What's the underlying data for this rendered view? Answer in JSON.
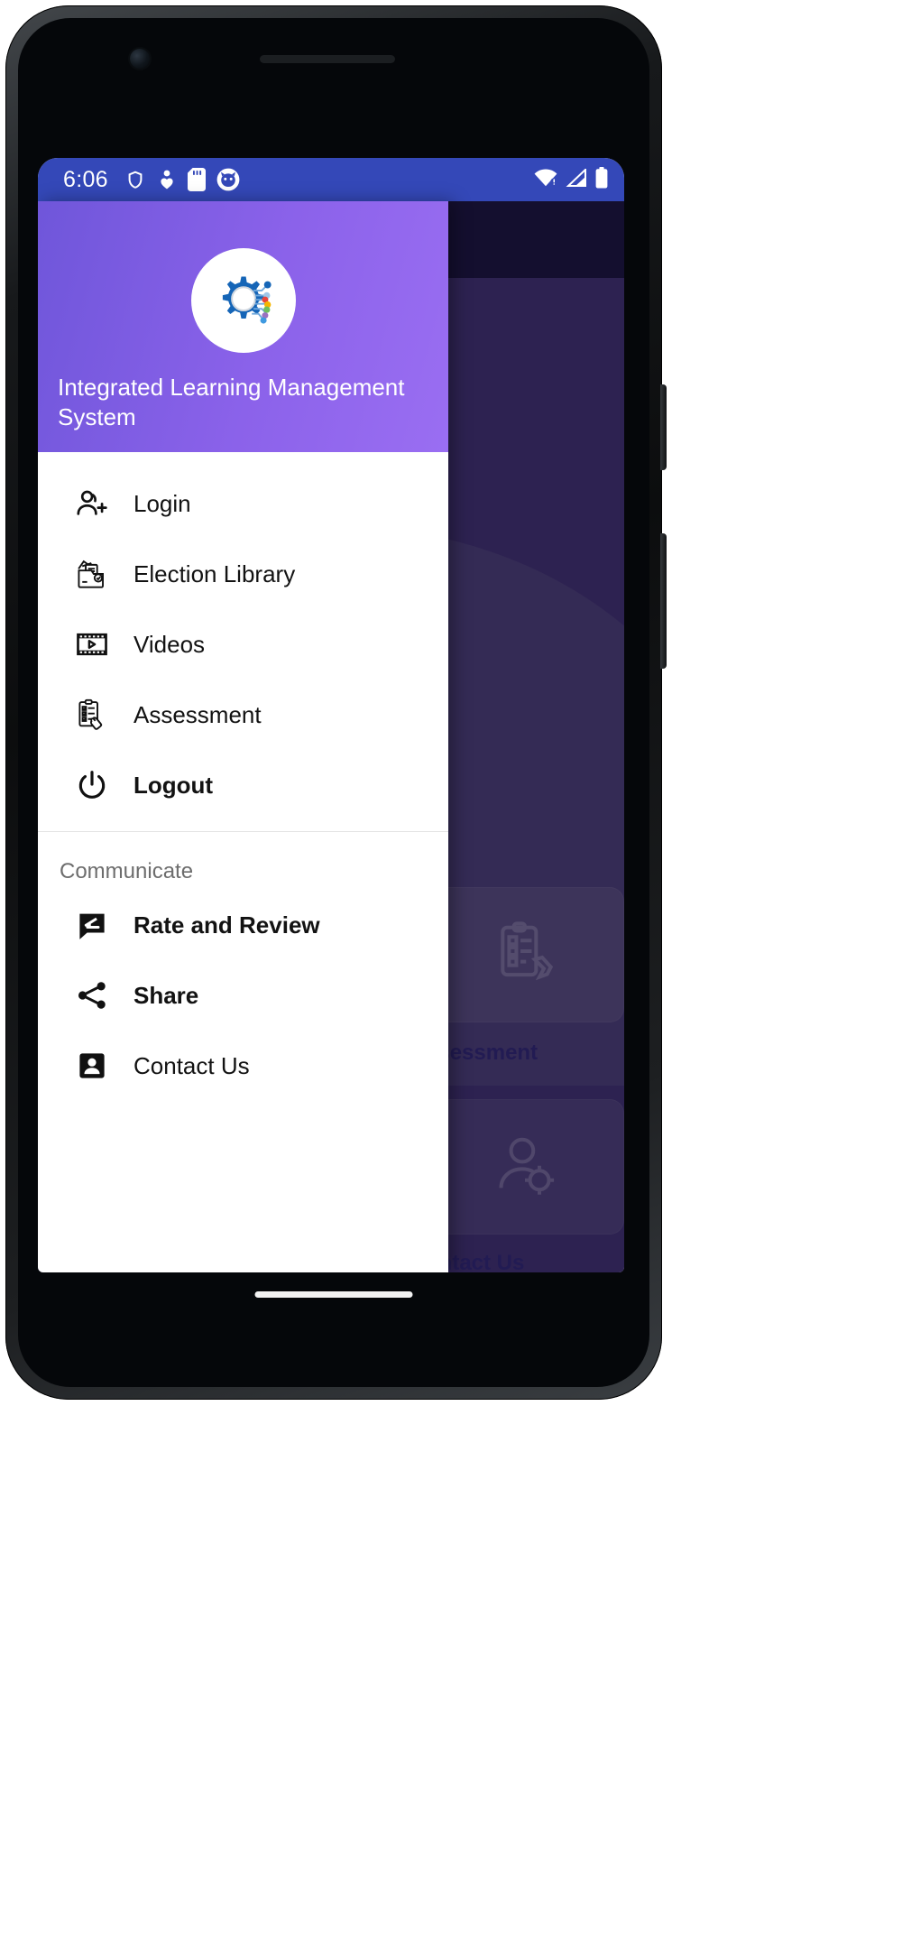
{
  "status_bar": {
    "time": "6:06",
    "left_icons": [
      "shield-icon",
      "person-heart-icon",
      "sd-card-icon",
      "cat-face-icon"
    ],
    "right_icons": [
      "wifi-icon",
      "cellular-signal-icon",
      "battery-icon"
    ],
    "background_color": "#3448b8"
  },
  "drawer": {
    "title": "Integrated Learning Management System",
    "logo_name": "ilms-gear-circuit-logo",
    "header_gradient_from": "#6f56da",
    "header_gradient_to": "#9a6ef2",
    "items": [
      {
        "label": "Login",
        "icon": "person-add-icon",
        "bold": false
      },
      {
        "label": "Election Library",
        "icon": "documents-folder-icon",
        "bold": false
      },
      {
        "label": "Videos",
        "icon": "film-strip-play-icon",
        "bold": false
      },
      {
        "label": "Assessment",
        "icon": "clipboard-hand-icon",
        "bold": false
      },
      {
        "label": "Logout",
        "icon": "power-icon",
        "bold": true
      }
    ],
    "section_label": "Communicate",
    "communicate_items": [
      {
        "label": "Rate and Review",
        "icon": "comment-edit-icon",
        "bold": true
      },
      {
        "label": "Share",
        "icon": "share-nodes-icon",
        "bold": true
      },
      {
        "label": "Contact Us",
        "icon": "contact-card-icon",
        "bold": false
      }
    ]
  },
  "background_app": {
    "cards": [
      {
        "label": "ssessment",
        "icon": "clipboard-check-icon"
      },
      {
        "label": "ontact Us",
        "icon": "user-gear-icon"
      }
    ],
    "surface_color": "#4e3b8c",
    "topbar_color": "#241a52",
    "label_color": "#3c2f8f"
  },
  "device": {
    "frame_name": "android-phone-frame"
  }
}
